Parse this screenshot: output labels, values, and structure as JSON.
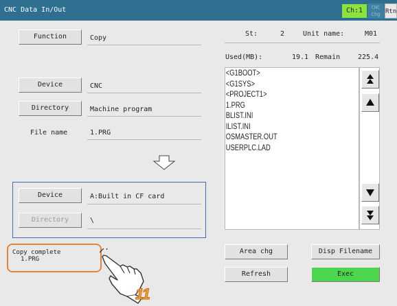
{
  "titlebar": {
    "title": "CNC Data In/Out",
    "channel": "Ch:1",
    "cnc_chg": "CNC\nChg",
    "rtn": "Rtn"
  },
  "left": {
    "function_button": "Function",
    "function_value": "Copy",
    "device_button": "Device",
    "device_value": "CNC",
    "directory_button": "Directory",
    "directory_value": "Machine program",
    "file_name_label": "File name",
    "file_name_value": "1.PRG",
    "dest_device_button": "Device",
    "dest_device_value": "A:Built in CF card",
    "dest_directory_button": "Directory",
    "dest_directory_value": "\\"
  },
  "info": {
    "st_label": "St:",
    "st_value": "2",
    "unit_label": "Unit name:",
    "unit_value": "M01",
    "used_label": "Used(MB):",
    "used_value": "19.1",
    "remain_label": "Remain",
    "remain_value": "225.4"
  },
  "file_list": [
    "<G1BOOT>",
    "<G1SYS>",
    "<PROJECT1>",
    "1.PRG",
    "BLIST.INI",
    "ILIST.INI",
    "OSMASTER.OUT",
    "USERPLC.LAD"
  ],
  "scroll_icons": [
    "double-up-icon",
    "up-icon",
    "down-icon",
    "double-down-icon"
  ],
  "buttons": {
    "area_chg": "Area chg",
    "disp_filename": "Disp Filename",
    "refresh": "Refresh",
    "exec": "Exec"
  },
  "status": {
    "line1": "Copy complete",
    "line2": "1.PRG"
  },
  "annotation": {
    "step": "11"
  },
  "colors": {
    "titlebar": "#2f6f8f",
    "channel": "#8ce23e",
    "exec": "#4bd64e",
    "dest_box": "#3b6eb5",
    "status_border": "#e7843b",
    "step": "#f2a33a"
  }
}
